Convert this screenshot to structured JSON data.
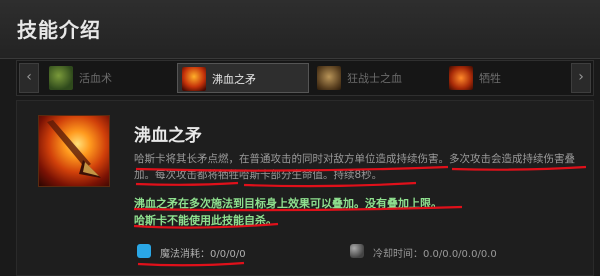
{
  "header": {
    "title": "技能介绍"
  },
  "tabs": {
    "prev_arrow": "‹",
    "next_arrow": "›",
    "items": [
      {
        "label": "活血术",
        "icon": "troll-skill-icon"
      },
      {
        "label": "沸血之矛",
        "icon": "burning-spear-icon",
        "active": true
      },
      {
        "label": "狂战士之血",
        "icon": "berserkers-blood-icon"
      },
      {
        "label": "牺牲",
        "icon": "sacrifice-icon"
      }
    ]
  },
  "skill": {
    "name": "沸血之矛",
    "description": "哈斯卡将其长矛点燃，在普通攻击的同时对敌方单位造成持续伤害。多次攻击会造成持续伤害叠加。每次攻击都将牺牲哈斯卡部分生命值。持续8秒。",
    "note1": "沸血之矛在多次施法到目标身上效果可以叠加。没有叠加上限。",
    "note2": "哈斯卡不能使用此技能自杀。",
    "mana_cost": "魔法消耗：0/0/0/0",
    "cooldown": "冷却时间：0.0/0.0/0.0/0.0"
  },
  "colors": {
    "mana": "#2aa7e6",
    "note": "#8fe08f",
    "underline": "#e0101a"
  }
}
